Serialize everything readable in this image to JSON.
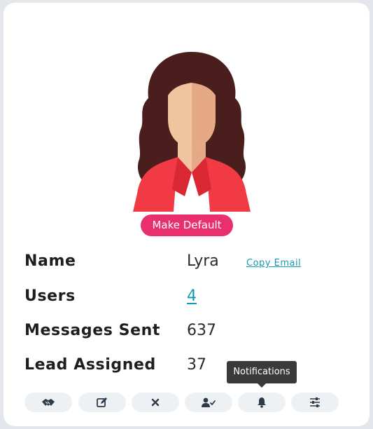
{
  "profile": {
    "make_default_label": "Make Default"
  },
  "details": {
    "name": {
      "label": "Name",
      "value": "Lyra",
      "copy_email_label": "Copy Email"
    },
    "users": {
      "label": "Users",
      "value": "4"
    },
    "messages_sent": {
      "label": "Messages Sent",
      "value": "637"
    },
    "lead_assigned": {
      "label": "Lead Assigned",
      "value": "37"
    }
  },
  "tooltip": {
    "text": "Notifications"
  },
  "actions": [
    {
      "icon": "handshake-icon"
    },
    {
      "icon": "edit-icon"
    },
    {
      "icon": "close-icon"
    },
    {
      "icon": "user-check-icon"
    },
    {
      "icon": "bell-icon"
    },
    {
      "icon": "sliders-icon"
    }
  ],
  "colors": {
    "accent": "#ea2f6f",
    "link": "#0f9bb0",
    "hair": "#4a1e1c",
    "skin": "#f1c4a0",
    "jacket": "#f23a45",
    "button_bg": "#eef1f4",
    "tooltip_bg": "#3a3a3a"
  }
}
